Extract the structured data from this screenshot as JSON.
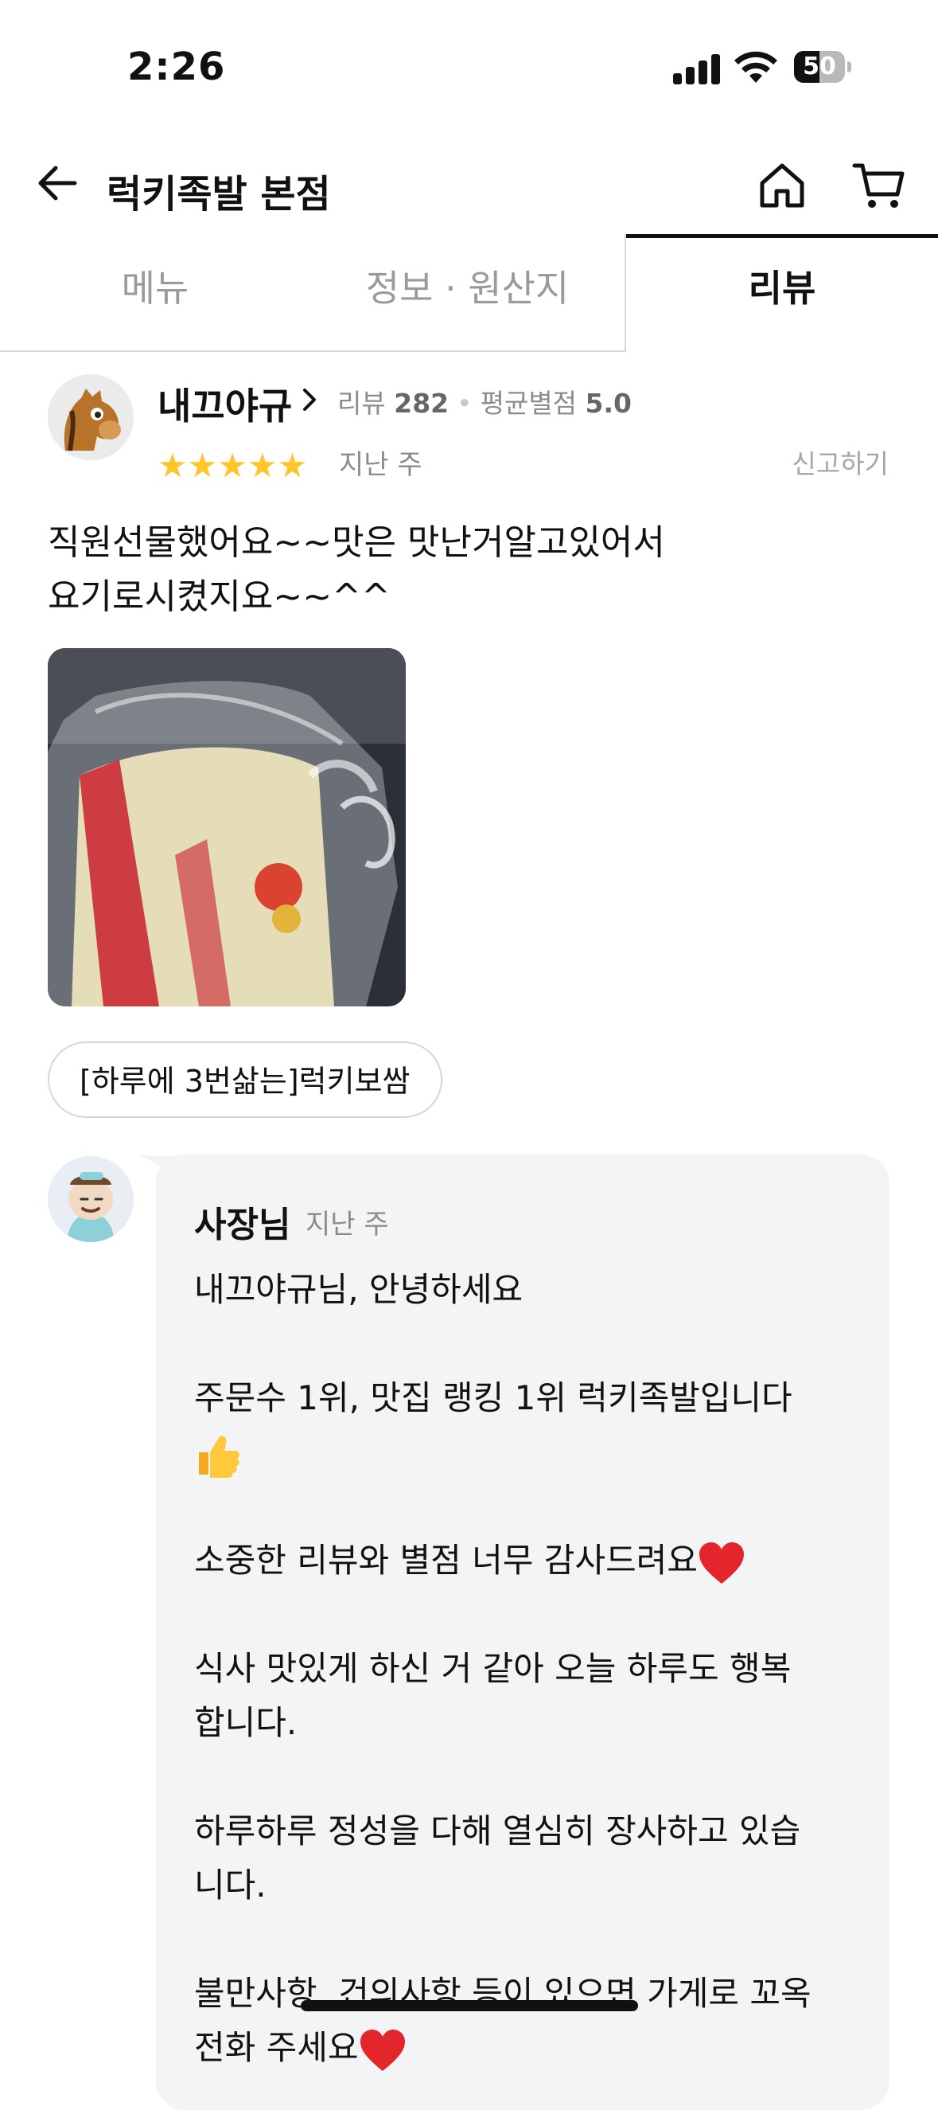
{
  "status_bar": {
    "time": "2:26",
    "battery": "50",
    "battery_level": 0.5
  },
  "header": {
    "title": "럭키족발 본점",
    "icons": [
      "back-arrow-icon",
      "home-icon",
      "cart-icon"
    ]
  },
  "tabs": [
    {
      "label": "메뉴",
      "active": false
    },
    {
      "label": "정보 · 원산지",
      "active": false
    },
    {
      "label": "리뷰",
      "active": true
    }
  ],
  "review": {
    "author": "내끄야규",
    "review_count_label": "리뷰",
    "review_count": "282",
    "avg_rating_label": "평균별점",
    "avg_rating": "5.0",
    "stars": "★★★★★",
    "rating": 5,
    "date": "지난 주",
    "report": "신고하기",
    "text": "직원선물했어요~~맛은 맛난거알고있어서\n요기로시켰지요~~^^",
    "menu_tag": "[하루에 3번삶는]럭키보쌈"
  },
  "owner_reply": {
    "author": "사장님",
    "date": "지난 주",
    "p1": "내끄야규님,  안녕하세요",
    "p2": "주문수 1위, 맛집 랭킹 1위 럭키족발입니다",
    "p3": "소중한 리뷰와 별점 너무 감사드려요",
    "p4": "식사 맛있게 하신 거 같아 오늘 하루도 행복\n합니다.",
    "p5": "하루하루 정성을 다해 열심히 장사하고 있습\n니다.",
    "p6": "불만사항, 건의사항 등이 있으면 가게로 꼬옥\n전화 주세요"
  },
  "colors": {
    "star": "#ffc52a",
    "reply_bg": "#f3f4f6",
    "muted": "#8c8c8c"
  }
}
